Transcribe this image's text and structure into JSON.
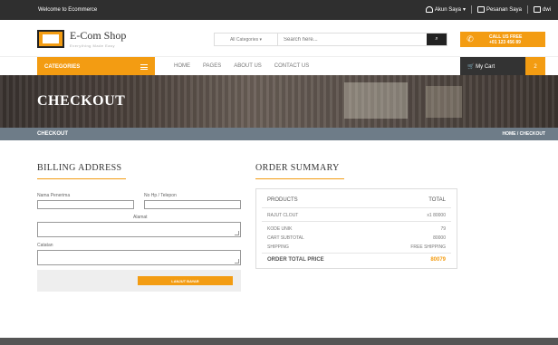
{
  "topbar": {
    "welcome": "Welcome to Ecommerce",
    "account": "Akun Saya",
    "orders": "Pesanan Saya",
    "user": "dwi"
  },
  "header": {
    "brand": "E-Com Shop",
    "tagline": "Everything Made Easy",
    "search_category": "All Categories",
    "search_placeholder": "Search here...",
    "call_line1": "CALL US FREE",
    "call_line2": "+01 123 456 89"
  },
  "nav": {
    "categories": "CATEGORIES",
    "links": [
      "HOME",
      "PAGES",
      "ABOUT US",
      "CONTACT US"
    ],
    "cart_label": "My Cart",
    "cart_count": "2"
  },
  "hero": {
    "title": "CHECKOUT"
  },
  "breadcrumb": {
    "current": "CHECKOUT",
    "trail": "HOME  /  CHECKOUT"
  },
  "billing": {
    "title": "BILLING ADDRESS",
    "name_label": "Nama Penerima",
    "phone_label": "No Hp / Telepon",
    "address_label": "Alamat",
    "notes_label": "Catatan",
    "submit": "LANJUT BAYAR"
  },
  "summary": {
    "title": "ORDER SUMMARY",
    "head_products": "PRODUCTS",
    "head_total": "TOTAL",
    "item_name": "RAJUT CLOUT",
    "item_value": "x1 80000",
    "unique_label": "KODE UNIK",
    "unique_value": "79",
    "subtotal_label": "CART SUBTOTAL",
    "subtotal_value": "80000",
    "shipping_label": "SHIPPING",
    "shipping_value": "FREE SHIPPING",
    "total_label": "ORDER TOTAL PRICE",
    "total_value": "80079"
  },
  "colors": {
    "accent": "#f39c12",
    "topbar": "#2f2f2f",
    "breadbar": "#6e7c88"
  }
}
